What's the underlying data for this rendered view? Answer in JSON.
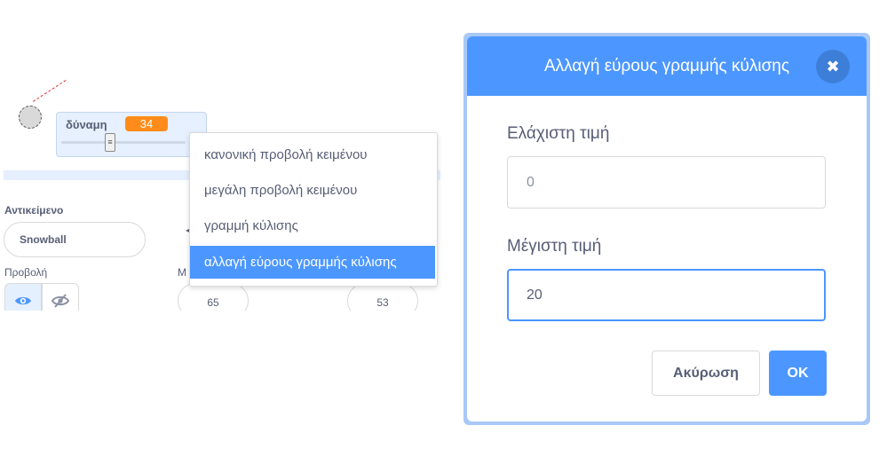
{
  "monitor": {
    "name": "δύναμη",
    "value": "34"
  },
  "sprite_info": {
    "sprite_label": "Αντικείμενο",
    "sprite_name": "Snowball",
    "show_label": "Προβολή",
    "size_label_partial": "Μ",
    "direction_partial": "◂",
    "size_value": "65",
    "direction_value": "53"
  },
  "context_menu": {
    "items": [
      {
        "label": "κανονική προβολή κειμένου"
      },
      {
        "label": "μεγάλη προβολή κειμένου"
      },
      {
        "label": "γραμμή κύλισης"
      },
      {
        "label": "αλλαγή εύρους γραμμής κύλισης"
      }
    ],
    "active_index": 3
  },
  "dialog": {
    "title": "Αλλαγή εύρους γραμμής κύλισης",
    "close_glyph": "✖",
    "min_label": "Ελάχιστη τιμή",
    "min_value": "0",
    "max_label": "Μέγιστη τιμή",
    "max_value": "20",
    "cancel_label": "Ακύρωση",
    "ok_label": "OK"
  },
  "colors": {
    "accent": "#4c97ff",
    "monitor_value": "#ff8c1a",
    "text": "#575e75"
  },
  "icons": [
    "eye-icon",
    "eye-off-icon",
    "close-icon",
    "slider-thumb-icon"
  ]
}
